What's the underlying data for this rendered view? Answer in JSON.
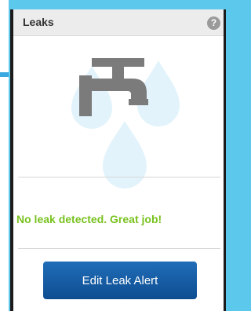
{
  "widget": {
    "title": "Leaks",
    "help_icon": "?",
    "illustration_icon": "faucet-with-water-drops-icon",
    "status": "No leak detected. Great job!",
    "action_label": "Edit Leak Alert"
  },
  "colors": {
    "background_accent": "#5bc8ec",
    "status_text": "#79c21f",
    "button": "#1a62ad",
    "faucet": "#7b7b7b",
    "water_drop": "#e2f3fb"
  }
}
